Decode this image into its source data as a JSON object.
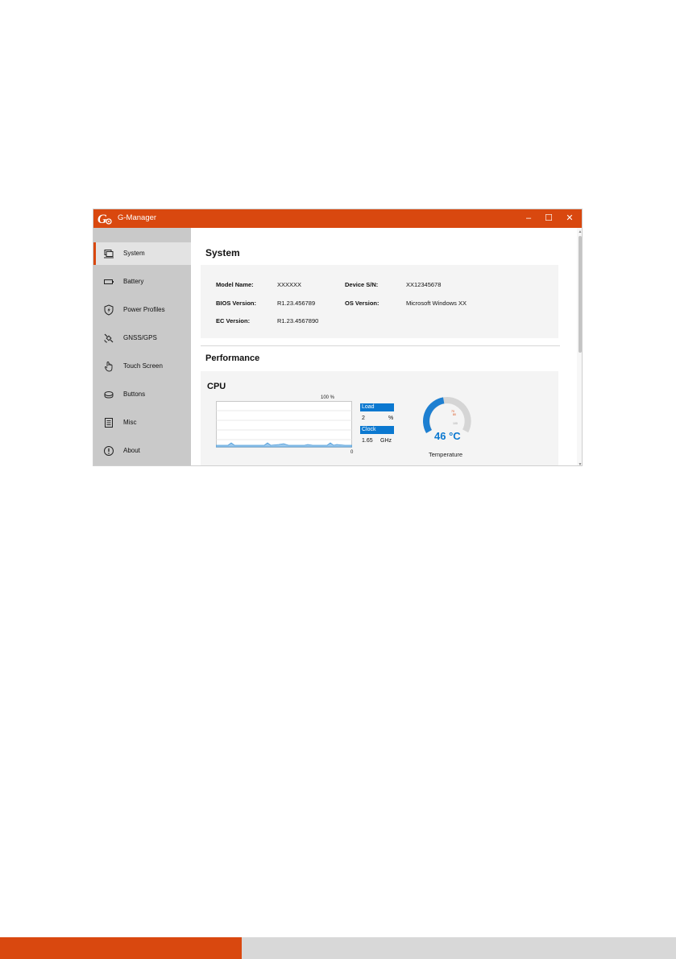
{
  "window": {
    "title": "G-Manager",
    "controls": {
      "minimize": "–",
      "maximize": "☐",
      "close": "✕"
    }
  },
  "sidebar": {
    "items": [
      {
        "label": "System",
        "icon": "laptop-icon",
        "active": true
      },
      {
        "label": "Battery",
        "icon": "battery-icon",
        "active": false
      },
      {
        "label": "Power Profiles",
        "icon": "power-shield-icon",
        "active": false
      },
      {
        "label": "GNSS/GPS",
        "icon": "satellite-icon",
        "active": false
      },
      {
        "label": "Touch Screen",
        "icon": "hand-touch-icon",
        "active": false
      },
      {
        "label": "Buttons",
        "icon": "buttons-icon",
        "active": false
      },
      {
        "label": "Misc",
        "icon": "list-icon",
        "active": false
      },
      {
        "label": "About",
        "icon": "info-icon",
        "active": false
      }
    ]
  },
  "system": {
    "title": "System",
    "fields": [
      {
        "label": "Model Name:",
        "value": "XXXXXX"
      },
      {
        "label": "Device S/N:",
        "value": "XX12345678"
      },
      {
        "label": "BIOS Version:",
        "value": "R1.23.456789"
      },
      {
        "label": "OS Version:",
        "value": "Microsoft Windows XX"
      },
      {
        "label": "EC Version:",
        "value": "R1.23.4567890"
      }
    ]
  },
  "performance": {
    "title": "Performance",
    "cpu": {
      "title": "CPU",
      "chart_max_label": "100 %",
      "chart_min_label": "0",
      "load_label": "Load",
      "load_value": "2",
      "load_unit": "%",
      "clock_label": "Clock",
      "clock_value": "1.65",
      "clock_unit": "GHz",
      "temperature_value": "46 °C",
      "temperature_label": "Temperature",
      "temperature_celsius": 46,
      "gauge_ticks": [
        "70",
        "80",
        "100"
      ]
    }
  },
  "colors": {
    "accent": "#d9480f",
    "blue": "#0b78d0",
    "sidebar_bg": "#c9c9c9",
    "card_bg": "#f4f4f4"
  }
}
